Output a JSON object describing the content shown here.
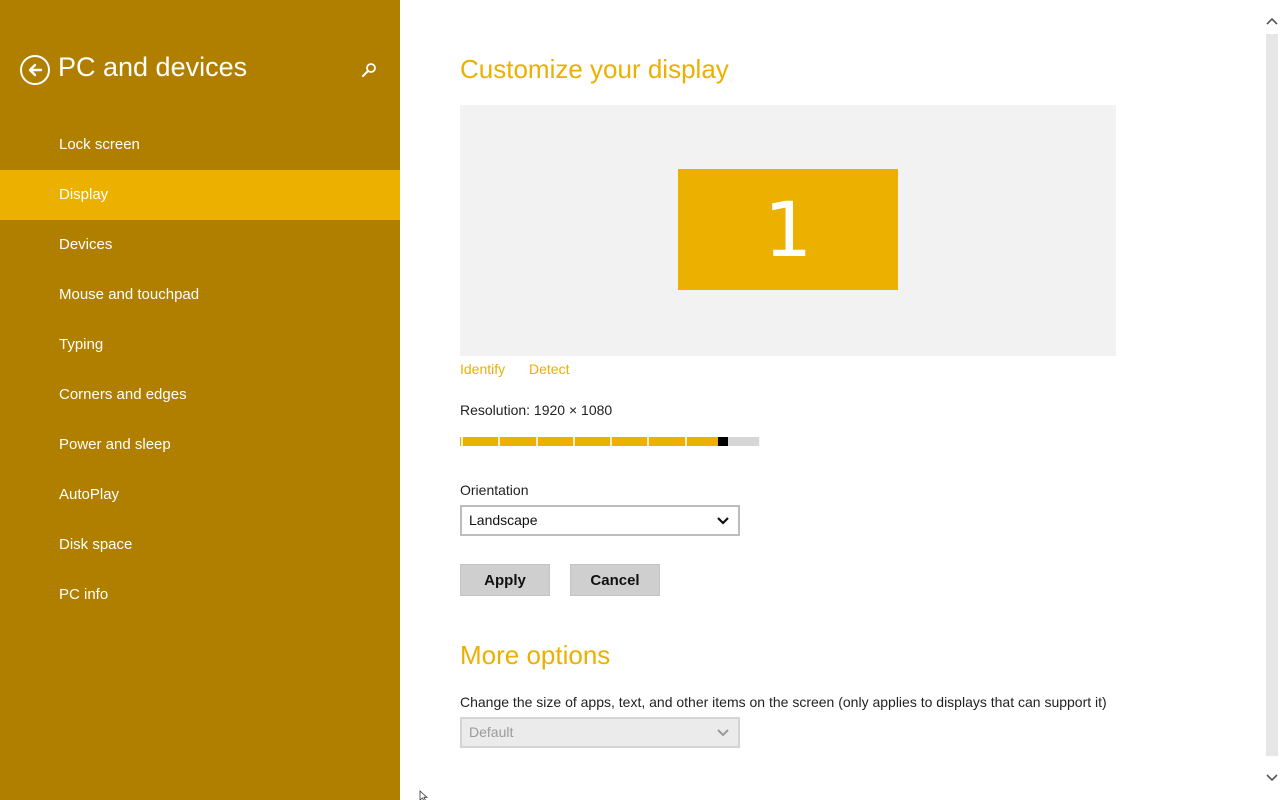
{
  "sidebar": {
    "title": "PC and devices",
    "back_icon": "back-arrow-circle-icon",
    "search_icon": "search-icon",
    "items": [
      {
        "label": "Lock screen",
        "selected": false
      },
      {
        "label": "Display",
        "selected": true
      },
      {
        "label": "Devices",
        "selected": false
      },
      {
        "label": "Mouse and touchpad",
        "selected": false
      },
      {
        "label": "Typing",
        "selected": false
      },
      {
        "label": "Corners and edges",
        "selected": false
      },
      {
        "label": "Power and sleep",
        "selected": false
      },
      {
        "label": "AutoPlay",
        "selected": false
      },
      {
        "label": "Disk space",
        "selected": false
      },
      {
        "label": "PC info",
        "selected": false
      }
    ]
  },
  "main": {
    "heading": "Customize your display",
    "monitor_number": "1",
    "identify_link": "Identify",
    "detect_link": "Detect",
    "resolution_label": "Resolution: 1920 × 1080",
    "resolution_slider": {
      "position_fraction": 0.86
    },
    "orientation_label": "Orientation",
    "orientation_value": "Landscape",
    "apply_label": "Apply",
    "cancel_label": "Cancel",
    "more_options_heading": "More options",
    "size_label": "Change the size of apps, text, and other items on the screen (only applies to displays that can support it)",
    "size_value": "Default"
  },
  "colors": {
    "sidebar_bg": "#b07f00",
    "accent": "#ebb000",
    "selected_item_bg": "#ebb000"
  }
}
